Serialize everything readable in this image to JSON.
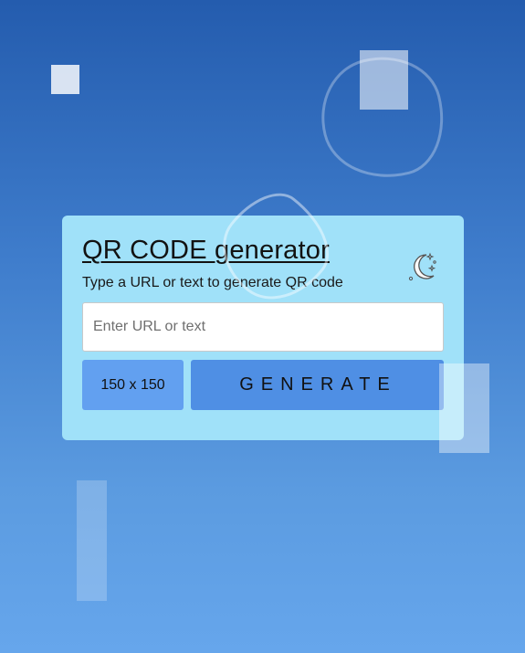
{
  "colors": {
    "background_top": "#245cae",
    "background_bottom": "#66a6ec",
    "card": "#a0e1f9",
    "size_select": "#62a0f0",
    "generate_button": "#4f8fe4"
  },
  "card": {
    "title": "QR CODE generator",
    "subtitle": "Type a URL or text to generate QR code",
    "theme_toggle_icon": "moon-stars-icon"
  },
  "form": {
    "url_input": {
      "placeholder": "Enter URL or text",
      "value": ""
    },
    "size_select": {
      "selected": "150 x 150"
    },
    "generate_label": "GENERATE"
  }
}
